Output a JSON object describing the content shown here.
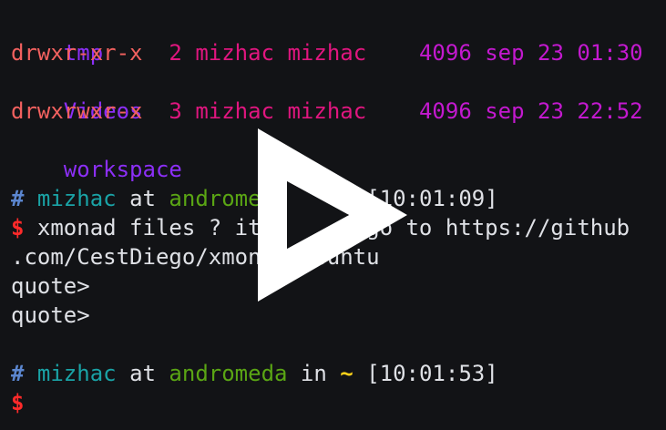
{
  "terminal": {
    "lines": [
      {
        "kind": "dir",
        "name": "tmp"
      },
      {
        "kind": "ls",
        "perms": "drwxr-xr-x",
        "links": "2",
        "owner": "mizhac",
        "group": "mizhac",
        "size": "4096",
        "date": "sep 23 01:30"
      },
      {
        "kind": "dir",
        "name": "Videos"
      },
      {
        "kind": "ls",
        "perms": "drwxrwxr-x",
        "links": "3",
        "owner": "mizhac",
        "group": "mizhac",
        "size": "4096",
        "date": "sep 23 22:52"
      },
      {
        "kind": "dir",
        "name": "workspace"
      },
      {
        "kind": "blank"
      },
      {
        "kind": "prompt",
        "hash": "#",
        "user": "mizhac",
        "at": "at",
        "host": "andromeda",
        "in": "in",
        "cwd": "~",
        "time": "[10:01:09]"
      },
      {
        "kind": "cmd",
        "dollar": "$",
        "text": "xmonad files ? it's easy go to https://github"
      },
      {
        "kind": "text",
        "text": ".com/CestDiego/xmonad-ubuntu"
      },
      {
        "kind": "text",
        "text": "quote>"
      },
      {
        "kind": "text",
        "text": "quote>"
      },
      {
        "kind": "blank"
      },
      {
        "kind": "prompt",
        "hash": "#",
        "user": "mizhac",
        "at": "at",
        "host": "andromeda",
        "in": "in",
        "cwd": "~",
        "time": "[10:01:53]"
      },
      {
        "kind": "cmd",
        "dollar": "$",
        "text": ""
      }
    ]
  },
  "overlay": {
    "icon": "play-icon"
  },
  "colors": {
    "background": "#121316",
    "perms": "#f2615f",
    "links_owner": "#e0167f",
    "size_date": "#c319cf",
    "directory": "#8c2ff7",
    "hash": "#5b86cf",
    "user": "#1aa3a6",
    "host": "#5aa514",
    "tilde": "#ffd21a",
    "dollar": "#ff2a2a",
    "text": "#dfe1e6"
  }
}
